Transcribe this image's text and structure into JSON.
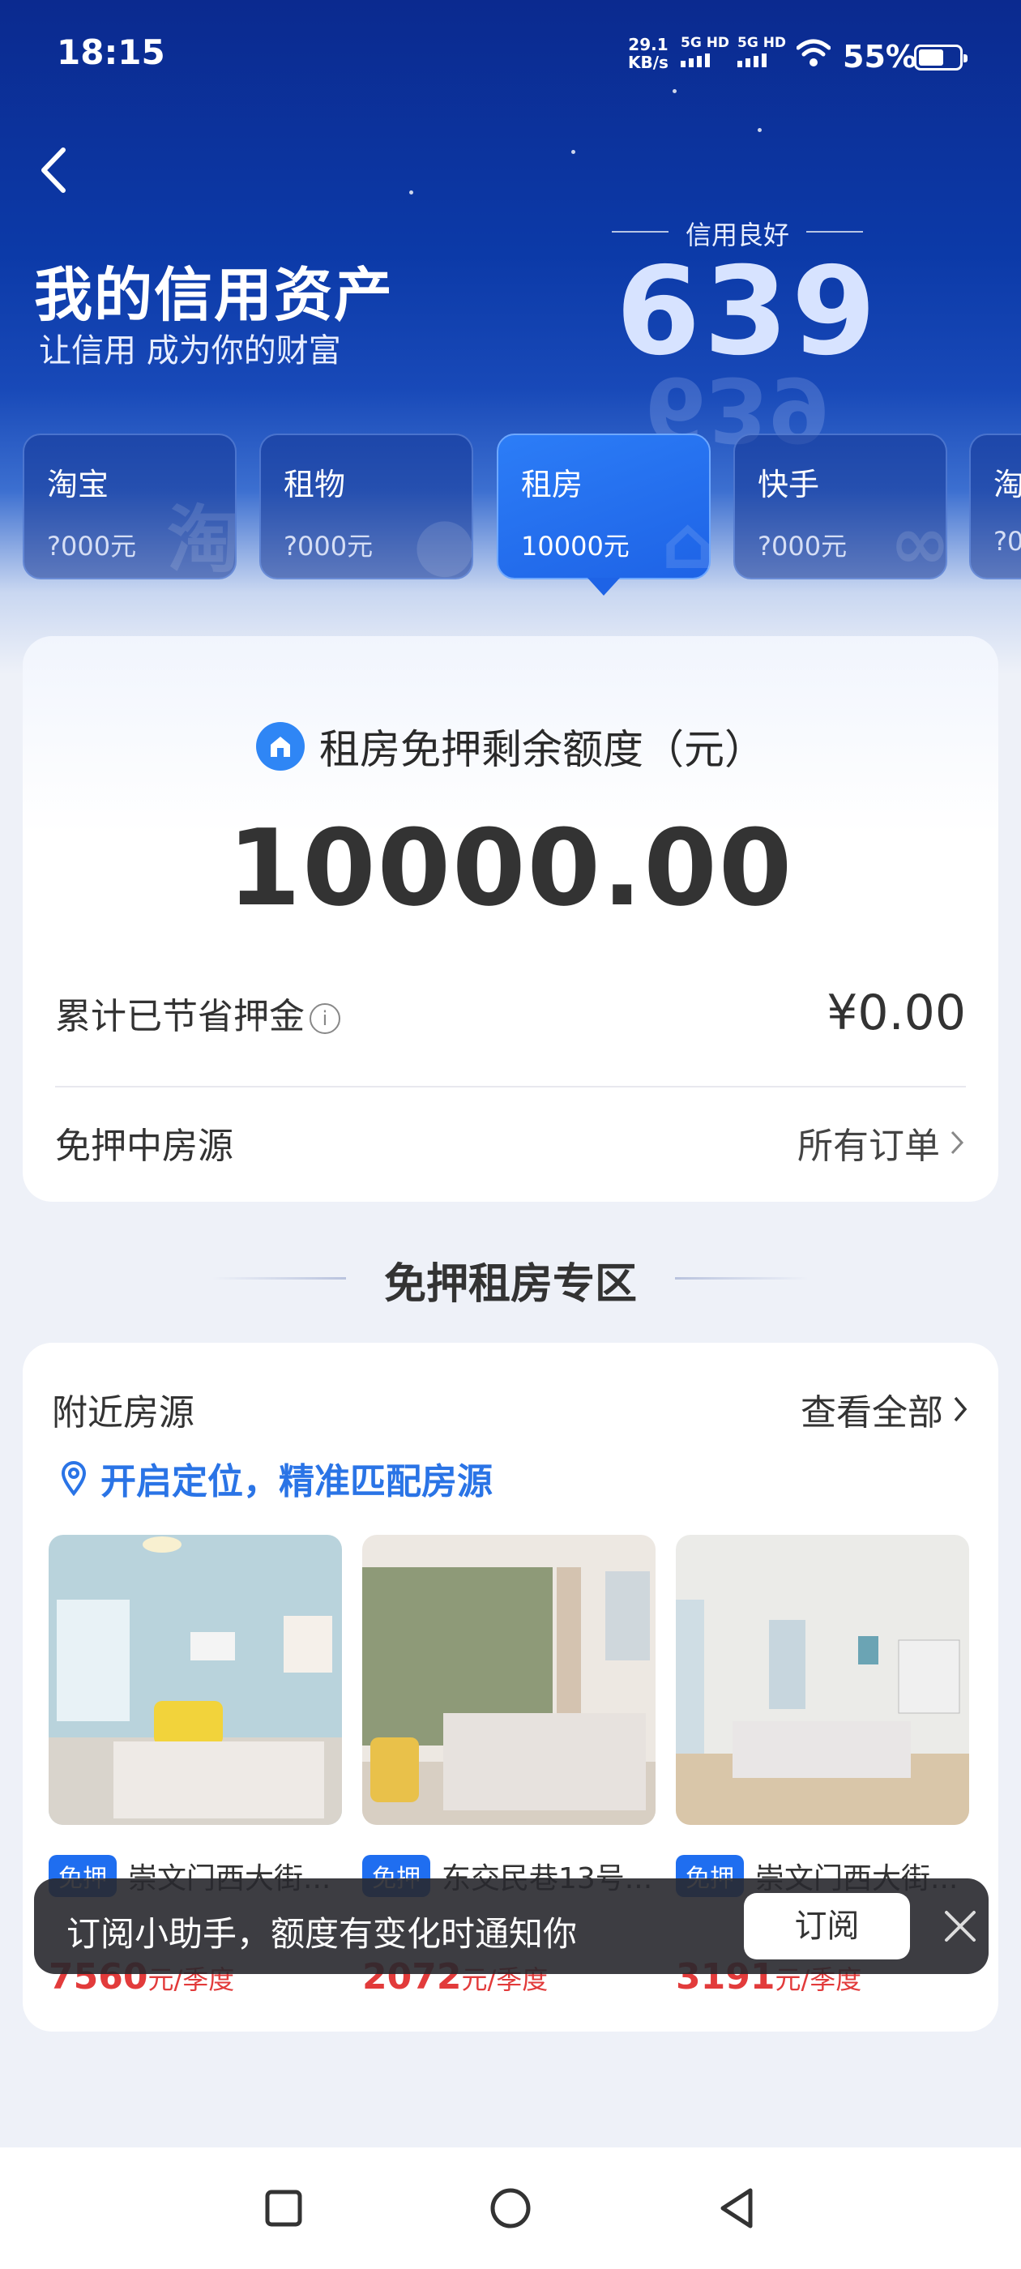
{
  "status_bar": {
    "time": "18:15",
    "net_speed_value": "29.1",
    "net_speed_unit": "KB/s",
    "sim1": "5G HD",
    "sim2": "5G HD",
    "battery": "55%"
  },
  "header": {
    "title": "我的信用资产",
    "subtitle": "让信用 成为你的财富",
    "credit_label": "信用良好",
    "credit_score": "639"
  },
  "tabs": [
    {
      "name": "淘宝",
      "amount": "?000元",
      "watermark": "淘"
    },
    {
      "name": "租物",
      "amount": "?000元",
      "watermark": "●"
    },
    {
      "name": "租房",
      "amount": "10000元",
      "watermark": "⌂"
    },
    {
      "name": "快手",
      "amount": "?000元",
      "watermark": "∞"
    },
    {
      "name": "淘",
      "amount": "?0",
      "watermark": ""
    }
  ],
  "quota": {
    "heading": "租房免押剩余额度（元）",
    "amount": "10000.00",
    "saved_label": "累计已节省押金",
    "saved_value": "¥0.00",
    "orders_label": "免押中房源",
    "all_orders": "所有订单"
  },
  "section_title": "免押租房专区",
  "nearby": {
    "title": "附近房源",
    "view_all": "查看全部",
    "location_prompt": "开启定位，精准匹配房源",
    "listings": [
      {
        "tag": "免押",
        "name": "崇文门西大街...",
        "price": "7560",
        "unit": "元/季度"
      },
      {
        "tag": "免押",
        "name": "东交民巷13号...",
        "price": "2072",
        "unit": "元/季度"
      },
      {
        "tag": "免押",
        "name": "崇文门西大街...",
        "price": "3191",
        "unit": "元/季度"
      }
    ]
  },
  "toast": {
    "message": "订阅小助手，额度有变化时通知你",
    "button": "订阅"
  },
  "colors": {
    "accent_blue": "#1f6ef0",
    "price_red": "#e23b3b",
    "hero_dark": "#0b2a8f"
  }
}
